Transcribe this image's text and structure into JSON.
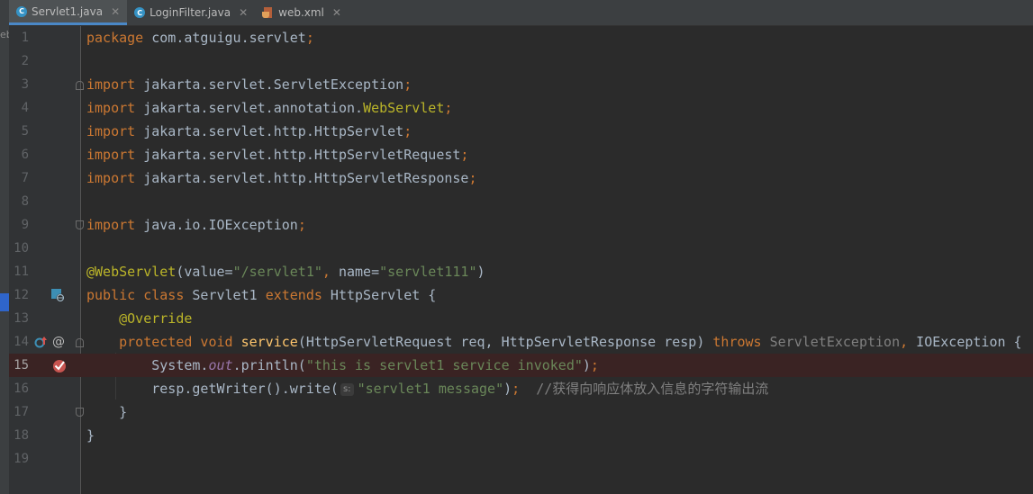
{
  "tabs": [
    {
      "label": "Servlet1.java",
      "icon": "java-class-icon",
      "active": true
    },
    {
      "label": "LoginFilter.java",
      "icon": "java-class-icon",
      "active": false
    },
    {
      "label": "web.xml",
      "icon": "xml-file-icon",
      "active": false
    }
  ],
  "project_fragment": "eb",
  "lines": [
    {
      "n": "1"
    },
    {
      "n": "2"
    },
    {
      "n": "3"
    },
    {
      "n": "4"
    },
    {
      "n": "5"
    },
    {
      "n": "6"
    },
    {
      "n": "7"
    },
    {
      "n": "8"
    },
    {
      "n": "9"
    },
    {
      "n": "10"
    },
    {
      "n": "11"
    },
    {
      "n": "12"
    },
    {
      "n": "13"
    },
    {
      "n": "14"
    },
    {
      "n": "15"
    },
    {
      "n": "16"
    },
    {
      "n": "17"
    },
    {
      "n": "18"
    },
    {
      "n": "19"
    }
  ],
  "code": {
    "l1": {
      "kw": "package",
      "rest": " com.atguigu.servlet",
      "semi": ";"
    },
    "l3": {
      "kw": "import",
      "rest": " jakarta.servlet.ServletException",
      "semi": ";"
    },
    "l4": {
      "kw": "import",
      "rest": " jakarta.servlet.annotation.",
      "ann": "WebServlet",
      "semi": ";"
    },
    "l5": {
      "kw": "import",
      "rest": " jakarta.servlet.http.HttpServlet",
      "semi": ";"
    },
    "l6": {
      "kw": "import",
      "rest": " jakarta.servlet.http.HttpServletRequest",
      "semi": ";"
    },
    "l7": {
      "kw": "import",
      "rest": " jakarta.servlet.http.HttpServletResponse",
      "semi": ";"
    },
    "l9": {
      "kw": "import",
      "rest": " java.io.IOException",
      "semi": ";"
    },
    "l11": {
      "ann": "@WebServlet",
      "p1": "(value=",
      "s1": "\"/servlet1\"",
      "c1": ", ",
      "p2": "name=",
      "s2": "\"servlet111\"",
      "end": ")"
    },
    "l12": {
      "kw1": "public class",
      "name": " Servlet1 ",
      "kw2": "extends",
      "rest": " HttpServlet {"
    },
    "l13": {
      "ann": "@Override"
    },
    "l14": {
      "kw1": "protected void",
      "sp": " ",
      "fn": "service",
      "args": "(HttpServletRequest req, HttpServletResponse resp) ",
      "kw2": "throws",
      "ex1": " ServletException",
      "c": ", ",
      "ex2": "IOException {"
    },
    "l15": {
      "a": "System.",
      "out": "out",
      "b": ".println(",
      "s": "\"this is servlet1 service invoked\"",
      "c": ")",
      "semi": ";"
    },
    "l16": {
      "a": "resp.getWriter().write(",
      "hint": "s:",
      "s": "\"servlet1 message\"",
      "c": ")",
      "semi": ";",
      "comment": "//获得向响应体放入信息的字符输出流"
    },
    "l17": {
      "text": "}"
    },
    "l18": {
      "text": "}"
    }
  },
  "colors": {
    "keyword": "#cc7832",
    "annotation": "#bbb529",
    "string": "#6a8759",
    "method": "#ffc66d",
    "field": "#9876aa",
    "text": "#a9b7c6",
    "comment": "#808080",
    "breakpoint_line": "#3a2323"
  }
}
